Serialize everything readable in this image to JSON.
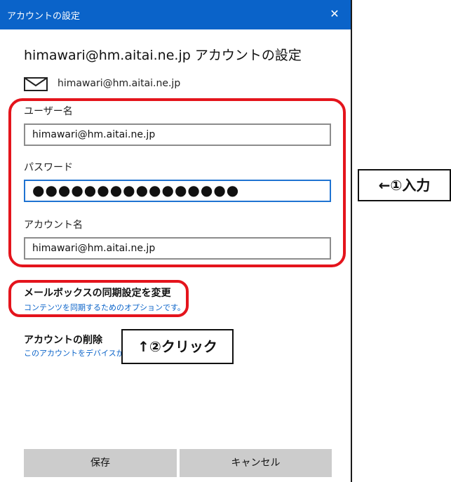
{
  "window": {
    "title": "アカウントの設定",
    "close_glyph": "✕"
  },
  "heading": "himawari@hm.aitai.ne.jp アカウントの設定",
  "email": {
    "icon": "mail-icon",
    "address": "himawari@hm.aitai.ne.jp"
  },
  "fields": {
    "username": {
      "label": "ユーザー名",
      "value": "himawari@hm.aitai.ne.jp"
    },
    "password": {
      "label": "パスワード",
      "value": "●●●●●●●●●●●●●●●●"
    },
    "account_name": {
      "label": "アカウント名",
      "value": "himawari@hm.aitai.ne.jp"
    }
  },
  "sync_settings": {
    "title": "メールボックスの同期設定を変更",
    "subtitle": "コンテンツを同期するためのオプションです。"
  },
  "delete_account": {
    "title": "アカウントの削除",
    "subtitle": "このアカウントをデバイスから削除します。"
  },
  "callouts": {
    "step1": "←①入力",
    "step2": "↑②クリック"
  },
  "buttons": {
    "save": "保存",
    "cancel": "キャンセル"
  },
  "colors": {
    "titlebar": "#0a63c9",
    "highlight": "#e4141c",
    "link": "#0a63c9",
    "focus_border": "#1f73d2"
  }
}
